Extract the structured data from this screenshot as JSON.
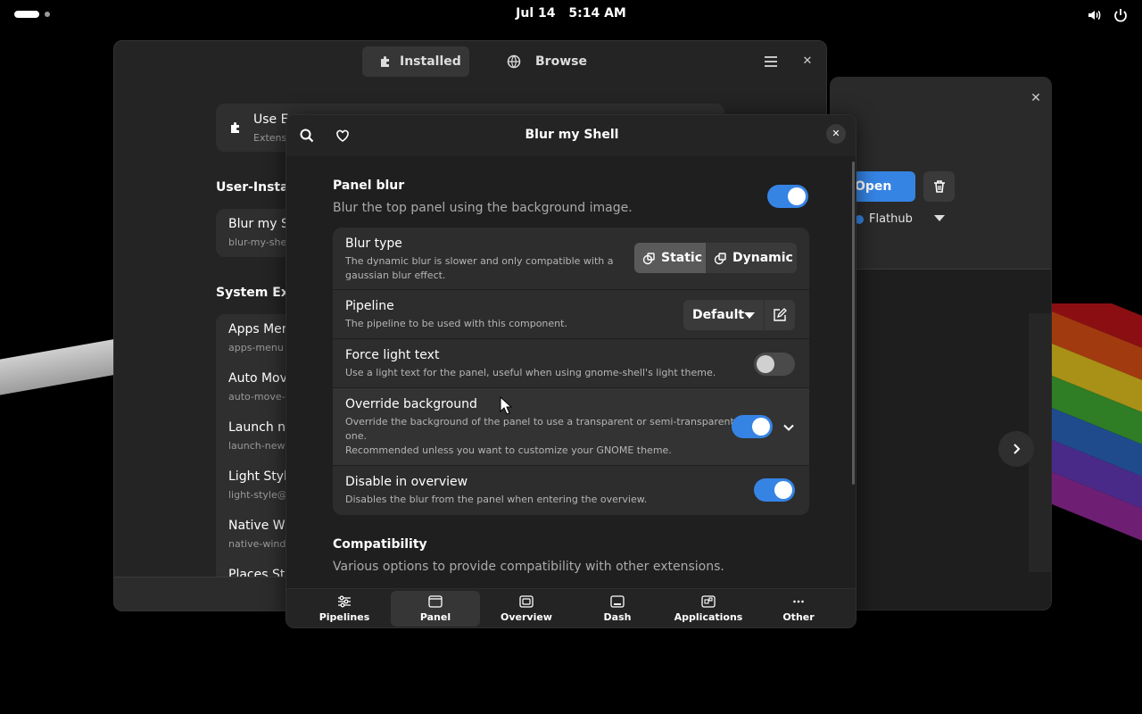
{
  "topbar": {
    "date": "Jul 14",
    "time": "5:14 AM",
    "volume_icon": "volume-icon",
    "power_icon": "power-icon"
  },
  "extensions_window": {
    "tabs": [
      {
        "label": "Installed",
        "icon": "puzzle-icon",
        "active": true
      },
      {
        "label": "Browse",
        "icon": "globe-icon",
        "active": false
      }
    ],
    "use_extensions": {
      "title": "Use E",
      "subtitle": "Extens"
    },
    "user_installed_heading": "User-Install",
    "user_installed": [
      {
        "title": "Blur my Sh",
        "subtitle": "blur-my-she"
      }
    ],
    "system_heading": "System Exte",
    "system": [
      {
        "title": "Apps Men",
        "subtitle": "apps-menu"
      },
      {
        "title": "Auto Move",
        "subtitle": "auto-move-"
      },
      {
        "title": "Launch ne",
        "subtitle": "launch-new"
      },
      {
        "title": "Light Style",
        "subtitle": "light-style@"
      },
      {
        "title": "Native Wi",
        "subtitle": "native-wind"
      },
      {
        "title": "Places Sta",
        "subtitle": ""
      }
    ]
  },
  "details_window": {
    "open_label": "Open",
    "source_label": "Flathub"
  },
  "dialog": {
    "title": "Blur my Shell",
    "panel_blur": {
      "title": "Panel blur",
      "subtitle": "Blur the top panel using the background image.",
      "enabled": true
    },
    "rows": {
      "blur_type": {
        "title": "Blur type",
        "subtitle_1": "The dynamic blur is slower and only compatible with a",
        "subtitle_2": "gaussian blur effect.",
        "options": [
          "Static",
          "Dynamic"
        ],
        "selected": "Static"
      },
      "pipeline": {
        "title": "Pipeline",
        "subtitle": "The pipeline to be used with this component.",
        "value": "Default"
      },
      "force_light_text": {
        "title": "Force light text",
        "subtitle": "Use a light text for the panel, useful when using gnome-shell's light theme.",
        "enabled": false
      },
      "override_background": {
        "title": "Override background",
        "subtitle_1": "Override the background of the panel to use a transparent or semi-transparent",
        "subtitle_2": "one.",
        "subtitle_3": "Recommended unless you want to customize your GNOME theme.",
        "enabled": true
      },
      "disable_in_overview": {
        "title": "Disable in overview",
        "subtitle": "Disables the blur from the panel when entering the overview.",
        "enabled": true
      }
    },
    "compatibility": {
      "title": "Compatibility",
      "subtitle": "Various options to provide compatibility with other extensions."
    },
    "nav": [
      {
        "label": "Pipelines",
        "icon": "sliders-icon",
        "active": false
      },
      {
        "label": "Panel",
        "icon": "panel-icon",
        "active": true
      },
      {
        "label": "Overview",
        "icon": "overview-icon",
        "active": false
      },
      {
        "label": "Dash",
        "icon": "dash-icon",
        "active": false
      },
      {
        "label": "Applications",
        "icon": "applications-icon",
        "active": false
      },
      {
        "label": "Other",
        "icon": "more-icon",
        "active": false
      }
    ]
  },
  "colors": {
    "accent": "#3584e4",
    "window_bg": "#242424",
    "dialog_bg": "#1f1f1f",
    "card_bg": "#2d2d2d"
  }
}
